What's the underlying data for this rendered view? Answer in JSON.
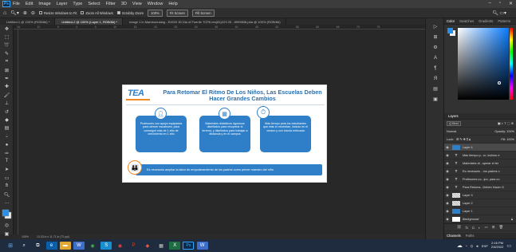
{
  "app": {
    "logo": "Ps"
  },
  "menu": [
    "File",
    "Edit",
    "Image",
    "Layer",
    "Type",
    "Select",
    "Filter",
    "3D",
    "View",
    "Window",
    "Help"
  ],
  "options": {
    "resize_windows": "Resize Windows to Fit",
    "zoom_all": "Zoom All Windows",
    "scrubby_zoom": "Scrubby Zoom",
    "zoom_value": "100%",
    "fit_screen": "Fit Screen",
    "fill_screen": "Fill Screen"
  },
  "tabs": [
    "Untitled-1 @ 100% (RGB/8#) *",
    "Untitled-2 @ 100% (Layer 1, RGB/8#) *",
    "image 1 in Mambonnaing - E0020 30 Dia of Fuente TCPA res(81)223 25 - 8999838.pba @ 100% (RGB/8#)"
  ],
  "ruler": [
    "16",
    "10",
    "5",
    "0",
    "5",
    "10",
    "15",
    "20",
    "25",
    "30",
    "35",
    "40",
    "45",
    "50",
    "55",
    "60",
    "65",
    "70",
    "75"
  ],
  "document": {
    "logo": "TEA",
    "title": "Para Retomar El Ritmo De Los Niños, Las Escuelas Deben Hacer Grandes Cambios",
    "card1": "Profesores con apoyo equipados para ofrecer escalones, para conseguir más de 1 año de crecimiento en 1 año",
    "card2": "Materiales didácticos rigurosos diseñados para recuperar el terreno, y diseñados para trabajar a distancia y en el campus",
    "card3": "Más tiempo para los estudiantes que más lo necesitan, incluso en el verano y con tutoría enfocada",
    "bottom_text": "Es necesario ampliar la labor de empoderamiento de los padres como primer maestro del niño"
  },
  "status": {
    "zoom": "100%",
    "size": "13.33 in x 11.71 in (72 ppi)"
  },
  "right_panel": {
    "tabs": [
      "Color",
      "Swatches",
      "Gradients",
      "Patterns"
    ],
    "layers_title": "Layers",
    "kind": "Q Kind",
    "blend": "Normal",
    "opacity": "Opacity: 100%",
    "lock": "Lock:",
    "fill": "Fill: 100%",
    "layers": [
      {
        "name": "Layer 4",
        "thumb": "img"
      },
      {
        "name": "Más tiempo p...rn, incluso e",
        "thumb": "T"
      },
      {
        "name": "Materiales di...operar el ter",
        "thumb": "T"
      },
      {
        "name": "Es necesario ...los padres c",
        "thumb": "T"
      },
      {
        "name": "Profesores co...ipo, para co",
        "thumb": "T"
      },
      {
        "name": "Para Retoma...Deben Hacer G",
        "thumb": "T"
      },
      {
        "name": "Layer 3",
        "thumb": "img"
      },
      {
        "name": "Layer 2",
        "thumb": "img"
      },
      {
        "name": "Layer 1",
        "thumb": "img"
      },
      {
        "name": "Background",
        "thumb": "bg"
      }
    ],
    "bottom_tabs": [
      "Channels",
      "Paths"
    ]
  },
  "taskbar": {
    "time": "2:16 PM",
    "date": "2/4/2022",
    "lang": "ESP"
  },
  "colors": {
    "accent": "#31a8ff",
    "doc_blue": "#2e7fc7",
    "doc_title": "#2f6fa8"
  }
}
